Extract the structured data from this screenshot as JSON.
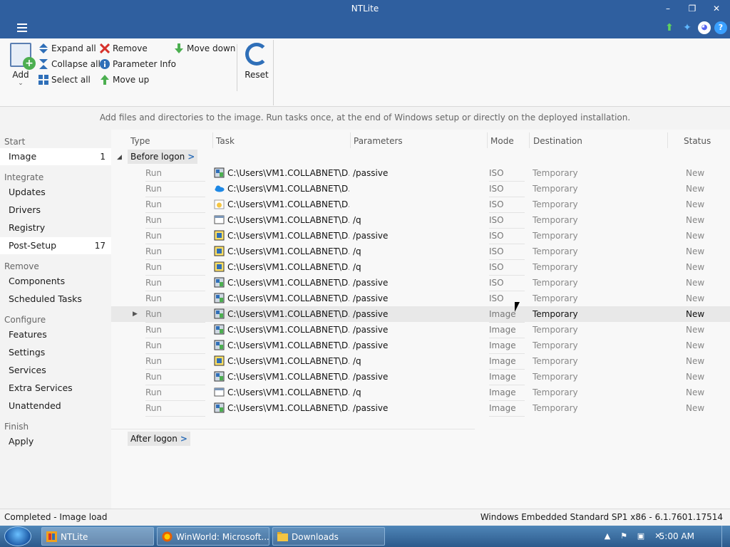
{
  "window": {
    "title": "NTLite"
  },
  "titlebar_buttons": {
    "minimize": "–",
    "maximize": "❐",
    "close": "✕"
  },
  "toolbar": {
    "add": "Add",
    "expand_all": "Expand all",
    "collapse_all": "Collapse all",
    "select_all": "Select all",
    "remove": "Remove",
    "parameter_info": "Parameter Info",
    "move_up": "Move up",
    "move_down": "Move down",
    "reset": "Reset"
  },
  "hint": "Add files and directories to the image. Run tasks once, at the end of Windows setup or directly on the deployed installation.",
  "sidebar": {
    "sections": [
      {
        "title": "Start",
        "items": [
          {
            "label": "Image",
            "count": "1"
          }
        ]
      },
      {
        "title": "Integrate",
        "items": [
          {
            "label": "Updates"
          },
          {
            "label": "Drivers"
          },
          {
            "label": "Registry"
          },
          {
            "label": "Post-Setup",
            "count": "17"
          }
        ]
      },
      {
        "title": "Remove",
        "items": [
          {
            "label": "Components"
          },
          {
            "label": "Scheduled Tasks"
          }
        ]
      },
      {
        "title": "Configure",
        "items": [
          {
            "label": "Features"
          },
          {
            "label": "Settings"
          },
          {
            "label": "Services"
          },
          {
            "label": "Extra Services"
          },
          {
            "label": "Unattended"
          }
        ]
      },
      {
        "title": "Finish",
        "items": [
          {
            "label": "Apply"
          }
        ]
      }
    ]
  },
  "columns": {
    "type": "Type",
    "task": "Task",
    "parameters": "Parameters",
    "mode": "Mode",
    "destination": "Destination",
    "status": "Status"
  },
  "groups": {
    "before": "Before logon",
    "after": "After logon",
    "arrow": ">"
  },
  "rows": [
    {
      "type": "Run",
      "task": "C:\\Users\\VM1.COLLABNET\\D...",
      "params": "/passive",
      "mode": "ISO",
      "dest": "Temporary",
      "status": "New"
    },
    {
      "type": "Run",
      "task": "C:\\Users\\VM1.COLLABNET\\D...",
      "params": "",
      "mode": "ISO",
      "dest": "Temporary",
      "status": "New"
    },
    {
      "type": "Run",
      "task": "C:\\Users\\VM1.COLLABNET\\D...",
      "params": "",
      "mode": "ISO",
      "dest": "Temporary",
      "status": "New"
    },
    {
      "type": "Run",
      "task": "C:\\Users\\VM1.COLLABNET\\D...",
      "params": "/q",
      "mode": "ISO",
      "dest": "Temporary",
      "status": "New"
    },
    {
      "type": "Run",
      "task": "C:\\Users\\VM1.COLLABNET\\D...",
      "params": "/passive",
      "mode": "ISO",
      "dest": "Temporary",
      "status": "New"
    },
    {
      "type": "Run",
      "task": "C:\\Users\\VM1.COLLABNET\\D...",
      "params": "/q",
      "mode": "ISO",
      "dest": "Temporary",
      "status": "New"
    },
    {
      "type": "Run",
      "task": "C:\\Users\\VM1.COLLABNET\\D...",
      "params": "/q",
      "mode": "ISO",
      "dest": "Temporary",
      "status": "New"
    },
    {
      "type": "Run",
      "task": "C:\\Users\\VM1.COLLABNET\\D...",
      "params": "/passive",
      "mode": "ISO",
      "dest": "Temporary",
      "status": "New"
    },
    {
      "type": "Run",
      "task": "C:\\Users\\VM1.COLLABNET\\D...",
      "params": "/passive",
      "mode": "ISO",
      "dest": "Temporary",
      "status": "New"
    },
    {
      "type": "Run",
      "task": "C:\\Users\\VM1.COLLABNET\\D...",
      "params": "/passive",
      "mode": "Image",
      "dest": "Temporary",
      "status": "New"
    },
    {
      "type": "Run",
      "task": "C:\\Users\\VM1.COLLABNET\\D...",
      "params": "/passive",
      "mode": "Image",
      "dest": "Temporary",
      "status": "New"
    },
    {
      "type": "Run",
      "task": "C:\\Users\\VM1.COLLABNET\\D...",
      "params": "/passive",
      "mode": "Image",
      "dest": "Temporary",
      "status": "New"
    },
    {
      "type": "Run",
      "task": "C:\\Users\\VM1.COLLABNET\\D...",
      "params": "/q",
      "mode": "Image",
      "dest": "Temporary",
      "status": "New"
    },
    {
      "type": "Run",
      "task": "C:\\Users\\VM1.COLLABNET\\D...",
      "params": "/passive",
      "mode": "Image",
      "dest": "Temporary",
      "status": "New"
    },
    {
      "type": "Run",
      "task": "C:\\Users\\VM1.COLLABNET\\D...",
      "params": "/q",
      "mode": "Image",
      "dest": "Temporary",
      "status": "New"
    },
    {
      "type": "Run",
      "task": "C:\\Users\\VM1.COLLABNET\\D...",
      "params": "/passive",
      "mode": "Image",
      "dest": "Temporary",
      "status": "New"
    }
  ],
  "row_icons": [
    "installer-icon",
    "onedrive-icon",
    "package-icon",
    "window-icon",
    "setup-icon",
    "setup-icon",
    "setup-icon",
    "installer-icon",
    "installer-icon",
    "installer-icon",
    "installer-icon",
    "installer-icon",
    "setup-icon",
    "installer-icon",
    "window-icon",
    "installer-icon"
  ],
  "statusbar": {
    "left": "Completed - Image load",
    "right": "Windows Embedded Standard SP1 x86 - 6.1.7601.17514"
  },
  "taskbar": {
    "buttons": [
      {
        "label": "NTLite"
      },
      {
        "label": "WinWorld: Microsoft..."
      },
      {
        "label": "Downloads"
      }
    ],
    "clock": "5:00 AM"
  },
  "colors": {
    "titlebar": "#2f5f9f",
    "accent": "#2f6fb8",
    "yellow_highlight": "#ffe68a"
  }
}
